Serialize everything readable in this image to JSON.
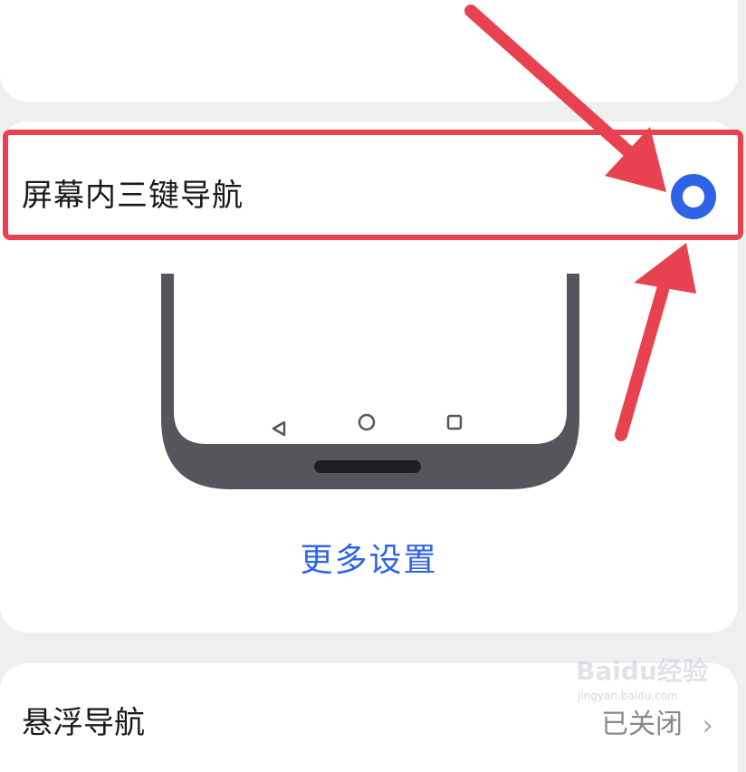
{
  "option": {
    "label": "屏幕内三键导航",
    "selected": true
  },
  "preview": {
    "nav_buttons": [
      "back-triangle-icon",
      "home-circle-icon",
      "recents-square-icon"
    ]
  },
  "more_settings_label": "更多设置",
  "floating_nav": {
    "label": "悬浮导航",
    "value": "已关闭"
  },
  "watermark": {
    "brand": "Baidu经验",
    "url": "jingyan.baidu.com"
  },
  "colors": {
    "accent": "#2f63e6",
    "annotation": "#e84250",
    "phone_frame": "#55565c",
    "background": "#efefef"
  }
}
